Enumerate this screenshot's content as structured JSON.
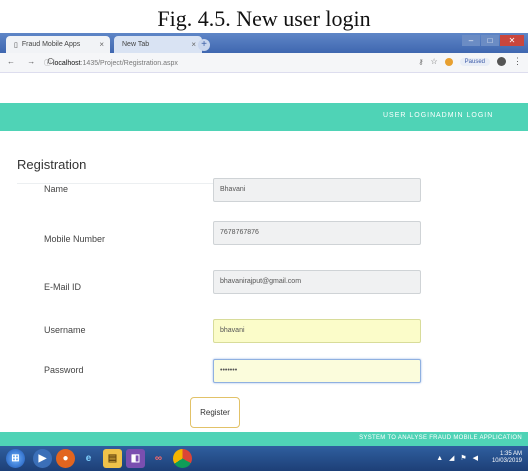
{
  "caption": "Fig. 4.5. New user login",
  "browser": {
    "tabs": [
      {
        "title": "Fraud Mobile Apps",
        "close": "×"
      },
      {
        "title": "New Tab",
        "close": "×"
      }
    ],
    "new_tab_symbol": "+",
    "window_controls": {
      "minimize": "–",
      "maximize": "□",
      "close": "✕"
    },
    "nav_symbols": "← → C",
    "url_host": "localhost",
    "url_path": ":1435/Project/Registration.aspx",
    "paused_label": "Paused",
    "menu_symbol": "⋮"
  },
  "nav": {
    "user_login": "USER LOGIN",
    "admin_login": "ADMIN LOGIN"
  },
  "form": {
    "heading": "Registration",
    "fields": [
      {
        "label": "Name",
        "value": "Bhavani"
      },
      {
        "label": "Mobile Number",
        "value": "7678767876"
      },
      {
        "label": "E-Mail ID",
        "value": "bhavanirajput@gmail.com"
      },
      {
        "label": "Username",
        "value": "bhavani"
      },
      {
        "label": "Password",
        "value": "•••••••"
      }
    ],
    "register_label": "Register"
  },
  "footer": {
    "text": "SYSTEM TO ANALYSE FRAUD MOBILE APPLICATION"
  },
  "taskbar": {
    "icons": [
      "start-orb-icon",
      "media-player-icon",
      "firefox-icon",
      "internet-explorer-icon",
      "file-explorer-icon",
      "visual-studio-icon",
      "app-icon",
      "chrome-icon"
    ],
    "tray_symbols": "▲ ◢ ⚑ ◀",
    "time": "1:35 AM",
    "date": "10/03/2019"
  },
  "colors": {
    "accent": "#4fd3b6",
    "taskbar": "#1d3f77",
    "button_border": "#e2c268"
  }
}
